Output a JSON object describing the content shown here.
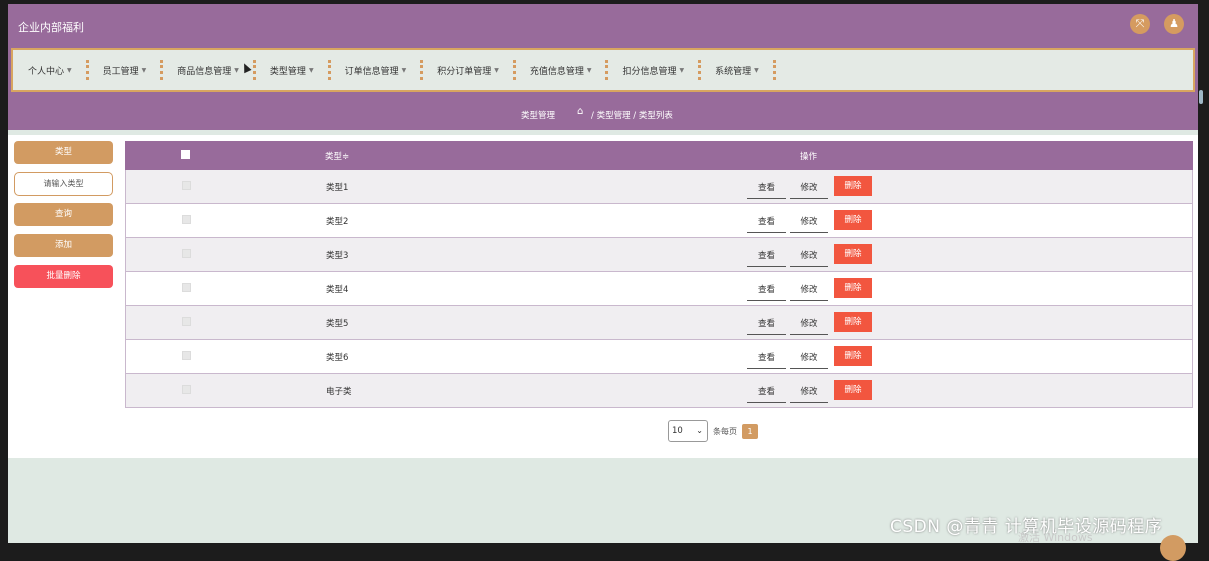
{
  "app": {
    "title": "企业内部福利"
  },
  "header_icons": [
    {
      "icon": "fullscreen-icon",
      "glyph": "⤧"
    },
    {
      "icon": "user-icon",
      "glyph": "♟"
    }
  ],
  "nav": [
    {
      "label": "个人中心"
    },
    {
      "label": "员工管理"
    },
    {
      "label": "商品信息管理"
    },
    {
      "label": "类型管理"
    },
    {
      "label": "订单信息管理"
    },
    {
      "label": "积分订单管理"
    },
    {
      "label": "充值信息管理"
    },
    {
      "label": "扣分信息管理"
    },
    {
      "label": "系统管理"
    }
  ],
  "breadcrumb": {
    "title": "类型管理",
    "path": "/ 类型管理 / 类型列表"
  },
  "sidebar": {
    "field_label": "类型",
    "search_placeholder": "请输入类型",
    "query_label": "查询",
    "add_label": "添加",
    "batch_delete_label": "批量删除"
  },
  "table": {
    "headers": {
      "type": "类型",
      "sort_mark": "≑",
      "ops": "操作"
    },
    "rows": [
      {
        "type": "类型1"
      },
      {
        "type": "类型2"
      },
      {
        "type": "类型3"
      },
      {
        "type": "类型4"
      },
      {
        "type": "类型5"
      },
      {
        "type": "类型6"
      },
      {
        "type": "电子类"
      }
    ],
    "actions": {
      "view": "查看",
      "edit": "修改",
      "delete": "删除"
    }
  },
  "pagination": {
    "page_size": "10",
    "per_page_label": "条每页",
    "current_page": "1"
  },
  "overlay": {
    "watermark": "CSDN @青青  计算机毕设源码程序",
    "windows_text": "激活 Windows"
  },
  "colors": {
    "primary": "#986b9b",
    "accent": "#d29b62",
    "danger": "#f2563f",
    "background": "#dfe9e3"
  }
}
